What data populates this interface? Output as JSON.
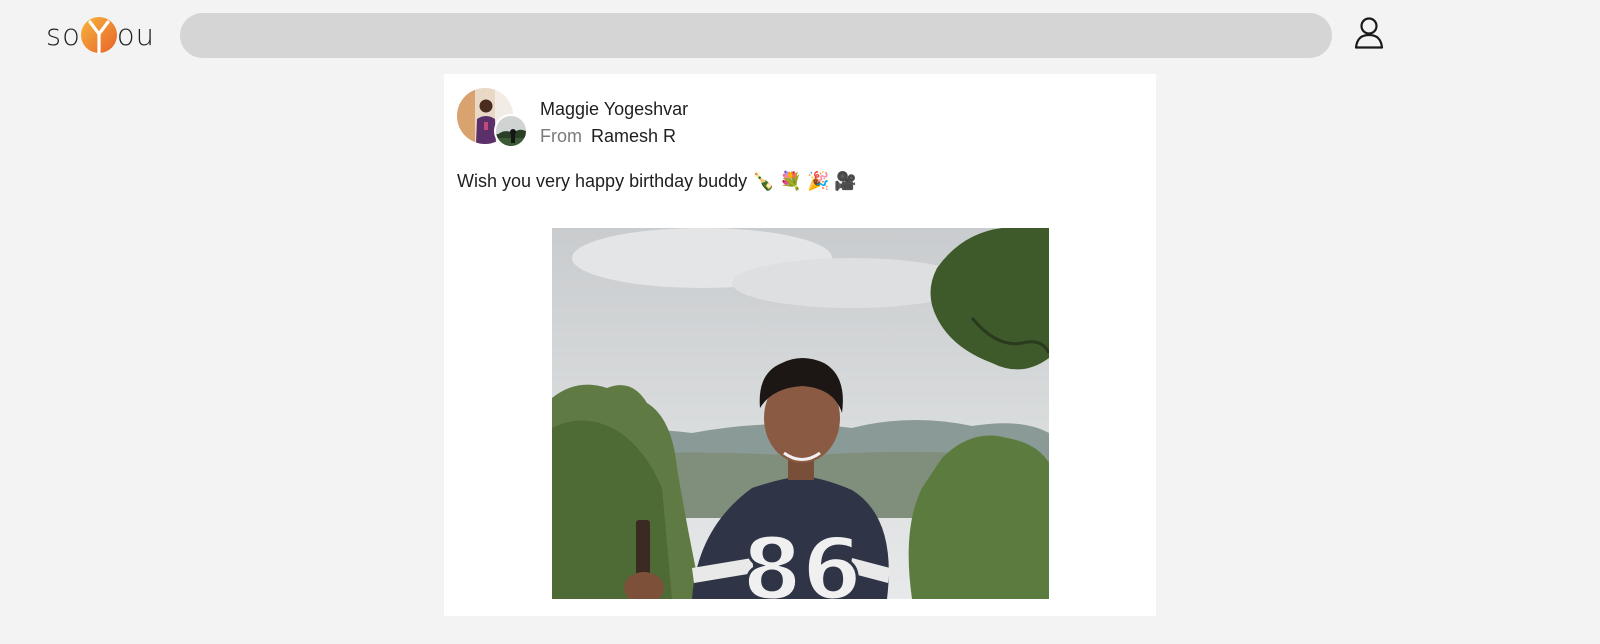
{
  "app": {
    "logo_text_left": "so",
    "logo_text_right": "ou",
    "accent_color": "#f08a2c"
  },
  "search": {
    "value": "",
    "placeholder": ""
  },
  "header": {
    "profile_icon": "user-icon"
  },
  "post": {
    "author": "Maggie Yogeshvar",
    "from_label": "From",
    "from_name": "Ramesh R",
    "message": "Wish you very happy birthday buddy 🍾 💐 🎉 🎥",
    "photo_jersey_number": "86"
  }
}
